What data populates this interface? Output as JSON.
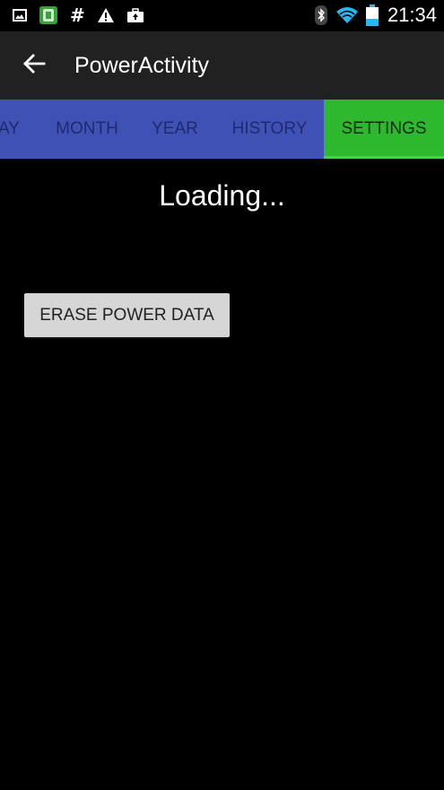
{
  "status_bar": {
    "time": "21:34",
    "left_icons": [
      "image-icon",
      "app-notification-icon",
      "hash-icon",
      "warning-icon",
      "briefcase-upload-icon"
    ],
    "right_icons": [
      "bluetooth-icon",
      "wifi-icon",
      "battery-icon"
    ],
    "hash_glyph": "#"
  },
  "toolbar": {
    "title": "PowerActivity",
    "back_icon": "arrow-back-icon"
  },
  "tabs": {
    "items": [
      {
        "label": "AY"
      },
      {
        "label": "MONTH"
      },
      {
        "label": "YEAR"
      },
      {
        "label": "HISTORY"
      },
      {
        "label": "SETTINGS",
        "selected": true
      }
    ],
    "colors": {
      "bar": "#3f51b5",
      "selected": "#2db82d"
    }
  },
  "content": {
    "loading_text": "Loading...",
    "erase_button_label": "ERASE POWER DATA"
  }
}
